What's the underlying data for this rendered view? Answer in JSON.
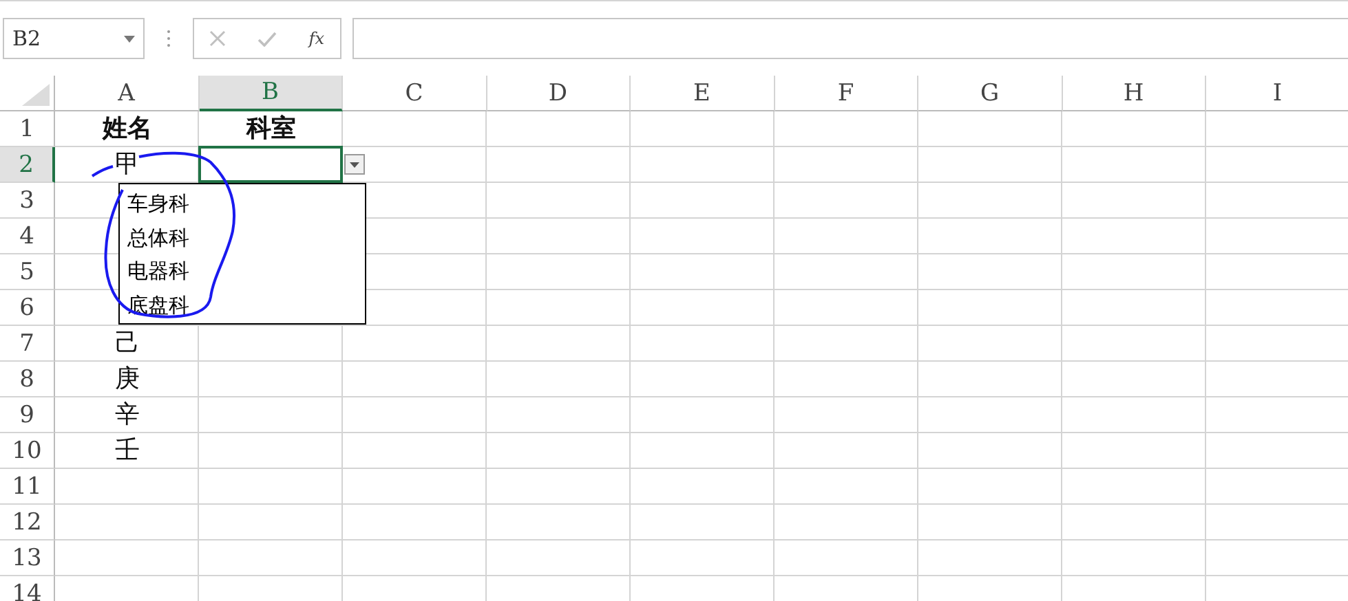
{
  "name_box": {
    "value": "B2"
  },
  "formula_bar": {
    "function_label": "fx"
  },
  "columns": [
    {
      "label": "A",
      "selected": false
    },
    {
      "label": "B",
      "selected": true
    },
    {
      "label": "C",
      "selected": false
    },
    {
      "label": "D",
      "selected": false
    },
    {
      "label": "E",
      "selected": false
    },
    {
      "label": "F",
      "selected": false
    },
    {
      "label": "G",
      "selected": false
    },
    {
      "label": "H",
      "selected": false
    },
    {
      "label": "I",
      "selected": false
    }
  ],
  "rows": [
    {
      "label": "1",
      "selected": false,
      "cells": [
        {
          "text": "姓名",
          "bold": true
        },
        {
          "text": "科室",
          "bold": true
        }
      ]
    },
    {
      "label": "2",
      "selected": true,
      "cells": [
        {
          "text": "甲",
          "bold": false
        }
      ]
    },
    {
      "label": "3",
      "selected": false
    },
    {
      "label": "4",
      "selected": false
    },
    {
      "label": "5",
      "selected": false
    },
    {
      "label": "6",
      "selected": false
    },
    {
      "label": "7",
      "selected": false,
      "cells": [
        {
          "text": "己",
          "bold": false
        }
      ]
    },
    {
      "label": "8",
      "selected": false,
      "cells": [
        {
          "text": "庚",
          "bold": false
        }
      ]
    },
    {
      "label": "9",
      "selected": false,
      "cells": [
        {
          "text": "辛",
          "bold": false
        }
      ]
    },
    {
      "label": "10",
      "selected": false,
      "cells": [
        {
          "text": "壬",
          "bold": false
        }
      ]
    },
    {
      "label": "11",
      "selected": false
    },
    {
      "label": "12",
      "selected": false
    },
    {
      "label": "13",
      "selected": false
    },
    {
      "label": "14",
      "selected": false
    }
  ],
  "dropdown": {
    "items": [
      "车身科",
      "总体科",
      "电器科",
      "底盘科"
    ]
  }
}
